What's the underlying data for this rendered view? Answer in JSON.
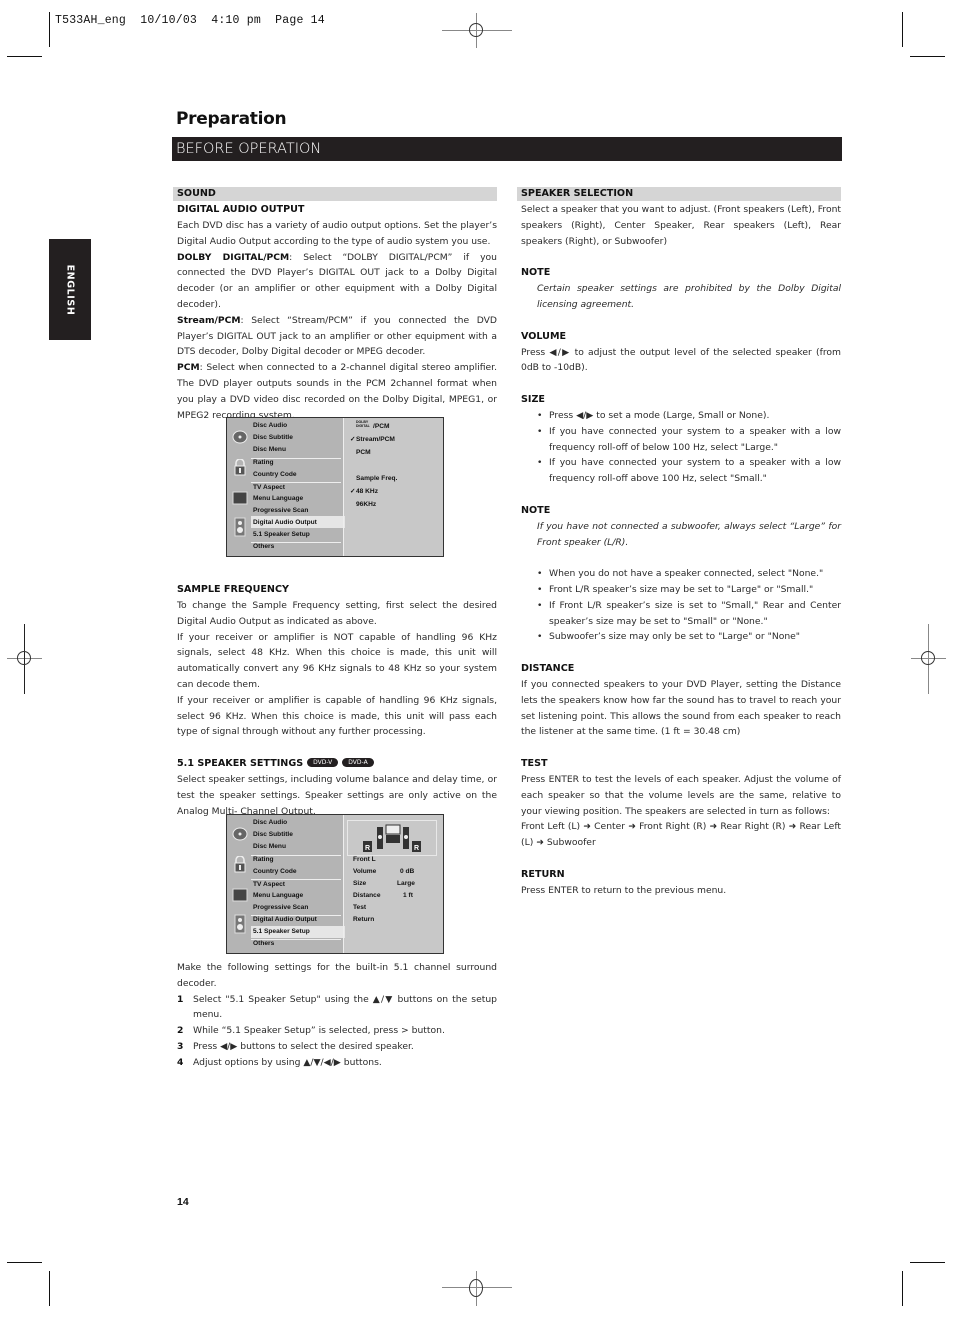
{
  "slug": "T533AH_eng  10/10/03  4:10 pm  Page 14",
  "header": {
    "title": "Preparation",
    "banner": "BEFORE OPERATION"
  },
  "language_tab": "ENGLISH",
  "left_column": {
    "section_title": "SOUND",
    "digital_audio_output": {
      "heading": "DIGITAL AUDIO OUTPUT",
      "intro": "Each DVD disc has a variety of audio output options. Set the player’s Digital Audio Output according to the type of audio system you use.",
      "dolby_label": "DOLBY DIGITAL/PCM",
      "dolby_text": ": Select “DOLBY DIGITAL/PCM” if you connected the DVD Player’s DIGITAL OUT jack to a Dolby Digital decoder (or an amplifier or other equipment with a Dolby Digital decoder).",
      "stream_label": "Stream/PCM",
      "stream_text": ": Select “Stream/PCM” if you connected the DVD Player’s DIGITAL OUT jack to an amplifier or other equipment with a DTS decoder, Dolby Digital decoder or MPEG decoder.",
      "pcm_label": "PCM",
      "pcm_text": ": Select when connected to a 2-channel digital stereo amplifier. The DVD player outputs sounds in the PCM 2channel format when you play a DVD video disc recorded on the Dolby Digital, MPEG1, or MPEG2 recording system."
    },
    "osd1": {
      "menu": [
        "Disc Audio",
        "Disc Subtitle",
        "Disc Menu",
        "Rating",
        "Country Code",
        "TV Aspect",
        "Menu Language",
        "Progressive Scan",
        "Digital Audio Output",
        "5.1 Speaker Setup",
        "Others"
      ],
      "selected": "Digital Audio Output",
      "options": {
        "dolby_logo_top": "DOLBY",
        "dolby_logo_bottom": "DIGITAL",
        "dolby_pcm": "/PCM",
        "stream_pcm": "Stream/PCM",
        "pcm": "PCM",
        "sample_freq": "Sample Freq.",
        "freq_48": "48 KHz",
        "freq_96": "96KHz",
        "check": "✓"
      }
    },
    "sample_frequency": {
      "heading": "SAMPLE FREQUENCY",
      "p1": "To change the Sample Frequency setting, first select the desired Digital Audio Output as indicated as above.",
      "p2": "If your receiver or amplifier is NOT capable of handling 96 KHz signals, select 48 KHz. When this choice is made, this unit will automatically convert any 96 KHz signals to 48 KHz so your system can decode them.",
      "p3": "If your receiver or amplifier is capable of handling 96 KHz signals, select 96 KHz. When this choice is made, this unit will pass each type of signal through without any further processing."
    },
    "speaker_settings": {
      "heading": "5.1 SPEAKER SETTINGS",
      "badges": [
        "DVD-V",
        "DVD-A"
      ],
      "intro": "Select speaker settings, including volume balance and delay time, or test the speaker settings. Speaker settings are only active on the Analog Multi- Channel Output."
    },
    "osd2": {
      "menu": [
        "Disc Audio",
        "Disc Subtitle",
        "Disc Menu",
        "Rating",
        "Country Code",
        "TV Aspect",
        "Menu Language",
        "Progressive Scan",
        "Digital Audio Output",
        "5.1 Speaker Setup",
        "Others"
      ],
      "selected": "5.1 Speaker Setup",
      "speaker_r_label": "R",
      "speaker": "Front L",
      "rows": [
        {
          "label": "Volume",
          "value": "0 dB"
        },
        {
          "label": "Size",
          "value": "Large"
        },
        {
          "label": "Distance",
          "value": "1 ft"
        },
        {
          "label": "Test",
          "value": ""
        },
        {
          "label": "Return",
          "value": ""
        }
      ]
    },
    "steps_intro": "Make the following settings for the built-in 5.1 channel surround decoder.",
    "steps": [
      {
        "n": "1",
        "text": "Select \"5.1 Speaker Setup\" using the ▲/▼ buttons on the setup menu."
      },
      {
        "n": "2",
        "text": "While “5.1 Speaker Setup” is selected, press > button."
      },
      {
        "n": "3",
        "text": "Press ◀/▶ buttons to select the desired speaker."
      },
      {
        "n": "4",
        "text": "Adjust options by using ▲/▼/◀/▶ buttons."
      }
    ]
  },
  "right_column": {
    "section_title": "SPEAKER SELECTION",
    "intro": "Select a speaker that you want to adjust. (Front speakers (Left), Front speakers (Right), Center Speaker, Rear speakers (Left), Rear speakers (Right), or Subwoofer)",
    "note1_heading": "NOTE",
    "note1": "Certain speaker settings are prohibited by the Dolby Digital licensing agreement.",
    "volume_heading": "VOLUME",
    "volume_text": "Press ◀/▶ to adjust the output level of the selected speaker (from 0dB to -10dB).",
    "size_heading": "SIZE",
    "size_bullets": [
      "Press ◀/▶ to set a mode (Large, Small or None).",
      "If you have connected your system to a speaker with a low frequency roll-off of below 100 Hz, select \"Large.\"",
      "If you have connected your system to a speaker with a low frequency roll-off above 100 Hz, select \"Small.\""
    ],
    "note2_heading": "NOTE",
    "note2": "If you have not connected a subwoofer, always select “Large” for Front speaker (L/R).",
    "more_bullets": [
      "When you do not have a speaker connected, select \"None.\"",
      "Front L/R speaker’s size may be set to \"Large\" or \"Small.\"",
      "If Front L/R speaker’s size is set to \"Small,\" Rear and Center speaker’s size may be set to \"Small\" or \"None.\"",
      "Subwoofer’s size may only be set to \"Large\" or \"None\""
    ],
    "distance_heading": "DISTANCE",
    "distance_text": "If you connected speakers to your DVD Player, setting the Distance lets the speakers know how far the sound has to travel to reach your set listening point. This allows the sound from each speaker to reach the listener at the same time. (1 ft = 30.48 cm)",
    "test_heading": "TEST",
    "test_text": "Press ENTER to test the levels of each speaker. Adjust the volume of each speaker so that the volume levels are the same, relative to your viewing position. The speakers are selected in turn as follows:",
    "test_sequence": "Front Left (L) ➜ Center ➜ Front Right (R) ➜ Rear Right (R) ➜ Rear Left (L) ➜ Subwoofer",
    "return_heading": "RETURN",
    "return_text": "Press ENTER to return to the previous menu."
  },
  "page_number": "14"
}
